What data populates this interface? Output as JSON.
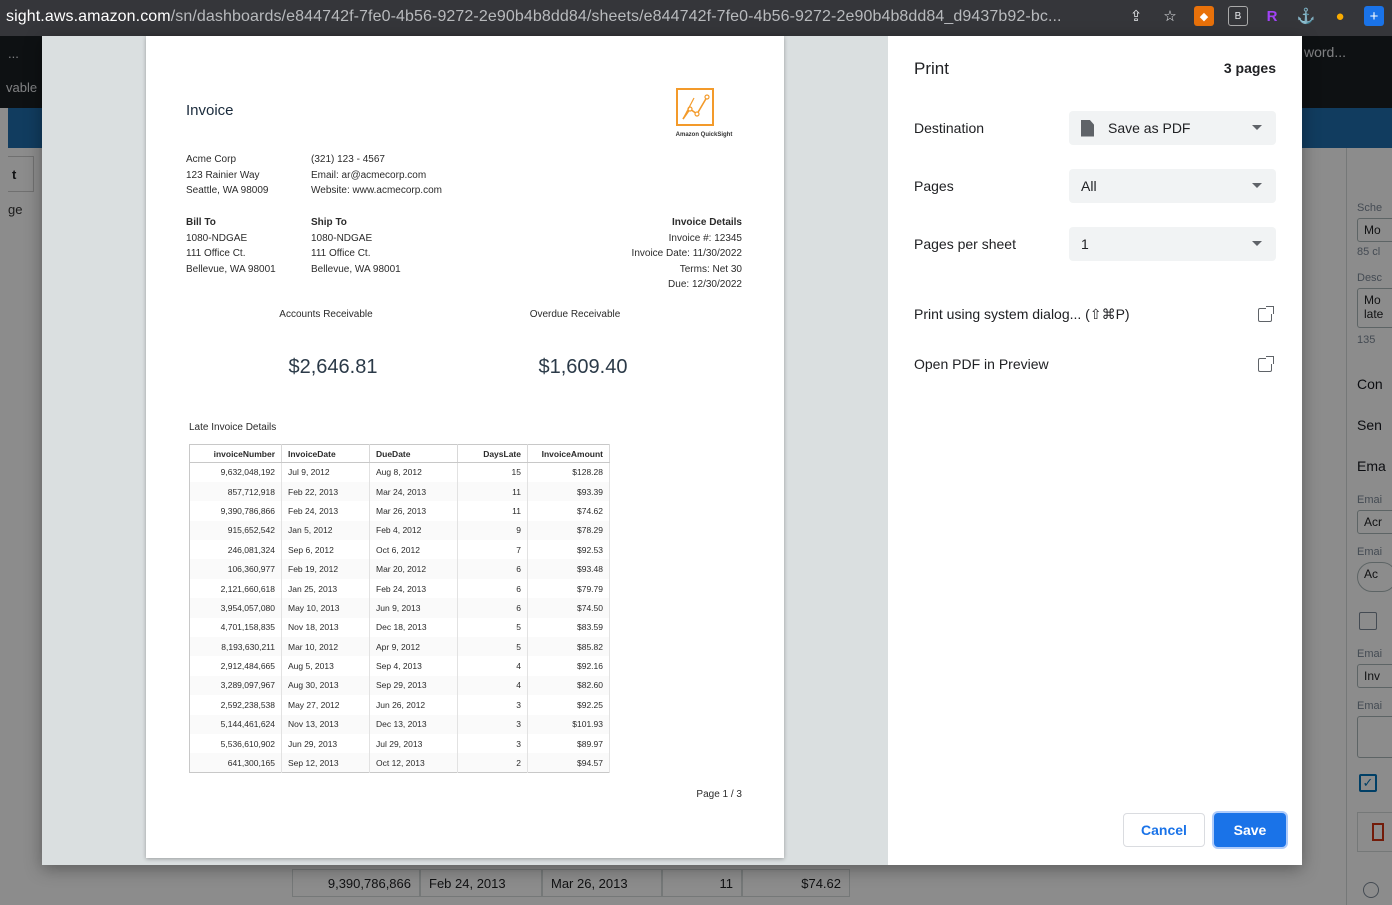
{
  "browser": {
    "url_host": "sight.aws.amazon.com",
    "url_path": "/sn/dashboards/e844742f-7fe0-4b56-9272-2e90b4b8dd84/sheets/e844742f-7fe0-4b56-9272-2e90b4b8dd84_d9437b92-bc...",
    "icons": [
      "share-icon",
      "star-icon",
      "extension-icon",
      "extension-icon",
      "extension-icon",
      "extension-icon",
      "extension-icon",
      "extension-icon"
    ]
  },
  "background": {
    "topbar_dots": "...",
    "topbar_word": "word...",
    "topbar_vable": "vable",
    "left_tab": "t",
    "left_ge": "ge",
    "right_panel": {
      "sche": "Sche",
      "mo": "Mo",
      "count1": "85 cl",
      "desc": "Desc",
      "mo2": "Mo",
      "late": "late",
      "count2": "135",
      "con": "Con",
      "sen": "Sen",
      "ema": "Ema",
      "emai1": "Emai",
      "acr": "Acr",
      "emai2": "Emai",
      "ac": "Ac",
      "emai3": "Emai",
      "inv": "Inv",
      "emai4": "Emai"
    },
    "table_row": [
      "9,390,786,866",
      "Feb 24, 2013",
      "Mar 26, 2013",
      "11",
      "$74.62"
    ]
  },
  "preview": {
    "invoice_title": "Invoice",
    "logo_text": "Amazon QuickSight",
    "company": [
      "Acme Corp",
      "123 Rainier Way",
      "Seattle, WA 98009"
    ],
    "contact": [
      "(321) 123 - 4567",
      "Email: ar@acmecorp.com",
      "Website: www.acmecorp.com"
    ],
    "bill_to": {
      "heading": "Bill To",
      "lines": [
        "1080-NDGAE",
        "111 Office Ct.",
        "Bellevue, WA 98001"
      ]
    },
    "ship_to": {
      "heading": "Ship To",
      "lines": [
        "1080-NDGAE",
        "111 Office Ct.",
        "Bellevue, WA 98001"
      ]
    },
    "invoice_details": {
      "heading": "Invoice Details",
      "lines": [
        "Invoice #: 12345",
        "Invoice Date: 11/30/2022",
        "Terms: Net 30",
        "Due: 12/30/2022"
      ]
    },
    "kpi": {
      "ar_label": "Accounts Receivable",
      "ar_value": "$2,646.81",
      "overdue_label": "Overdue Receivable",
      "overdue_value": "$1,609.40"
    },
    "table_title": "Late Invoice Details",
    "table_headers": [
      "invoiceNumber",
      "InvoiceDate",
      "DueDate",
      "DaysLate",
      "InvoiceAmount"
    ],
    "table_rows": [
      [
        "9,632,048,192",
        "Jul 9, 2012",
        "Aug 8, 2012",
        "15",
        "$128.28"
      ],
      [
        "857,712,918",
        "Feb 22, 2013",
        "Mar 24, 2013",
        "11",
        "$93.39"
      ],
      [
        "9,390,786,866",
        "Feb 24, 2013",
        "Mar 26, 2013",
        "11",
        "$74.62"
      ],
      [
        "915,652,542",
        "Jan 5, 2012",
        "Feb 4, 2012",
        "9",
        "$78.29"
      ],
      [
        "246,081,324",
        "Sep 6, 2012",
        "Oct 6, 2012",
        "7",
        "$92.53"
      ],
      [
        "106,360,977",
        "Feb 19, 2012",
        "Mar 20, 2012",
        "6",
        "$93.48"
      ],
      [
        "2,121,660,618",
        "Jan 25, 2013",
        "Feb 24, 2013",
        "6",
        "$79.79"
      ],
      [
        "3,954,057,080",
        "May 10, 2013",
        "Jun 9, 2013",
        "6",
        "$74.50"
      ],
      [
        "4,701,158,835",
        "Nov 18, 2013",
        "Dec 18, 2013",
        "5",
        "$83.59"
      ],
      [
        "8,193,630,211",
        "Mar 10, 2012",
        "Apr 9, 2012",
        "5",
        "$85.82"
      ],
      [
        "2,912,484,665",
        "Aug 5, 2013",
        "Sep 4, 2013",
        "4",
        "$92.16"
      ],
      [
        "3,289,097,967",
        "Aug 30, 2013",
        "Sep 29, 2013",
        "4",
        "$82.60"
      ],
      [
        "2,592,238,538",
        "May 27, 2012",
        "Jun 26, 2012",
        "3",
        "$92.25"
      ],
      [
        "5,144,461,624",
        "Nov 13, 2013",
        "Dec 13, 2013",
        "3",
        "$101.93"
      ],
      [
        "5,536,610,902",
        "Jun 29, 2013",
        "Jul 29, 2013",
        "3",
        "$89.97"
      ],
      [
        "641,300,165",
        "Sep 12, 2013",
        "Oct 12, 2013",
        "2",
        "$94.57"
      ]
    ],
    "page_number": "Page 1 / 3"
  },
  "print_settings": {
    "title": "Print",
    "pages_count": "3 pages",
    "destination_label": "Destination",
    "destination_value": "Save as PDF",
    "pages_label": "Pages",
    "pages_value": "All",
    "pps_label": "Pages per sheet",
    "pps_value": "1",
    "system_dialog": "Print using system dialog... (⇧⌘P)",
    "open_pdf": "Open PDF in Preview",
    "cancel": "Cancel",
    "save": "Save"
  },
  "colors": {
    "accent": "#1a73e8",
    "logo": "#f39a2a"
  }
}
